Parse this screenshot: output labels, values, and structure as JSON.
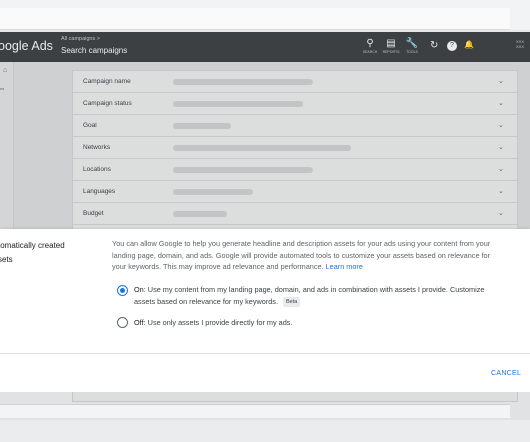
{
  "app": {
    "brand": "oogle Ads",
    "breadcrumb_small": "All campaigns  >",
    "breadcrumb_main": "Search campaigns",
    "tools": [
      {
        "icon": "search-icon",
        "glyph": "⚲",
        "label": "SEARCH"
      },
      {
        "icon": "reports-icon",
        "glyph": "▤",
        "label": "REPORTS"
      },
      {
        "icon": "tools-icon",
        "glyph": "🔧",
        "label": "TOOLS"
      }
    ],
    "refresh_icon": "↻",
    "help_icon": "?",
    "bell_icon": "🔔",
    "account_line1": "XXX",
    "account_line2": "XXX"
  },
  "leftnav": {
    "home_icon": "⌂",
    "text": "ns"
  },
  "settings_rows": [
    {
      "label": "Campaign name",
      "bar": 140
    },
    {
      "label": "Campaign status",
      "bar": 130
    },
    {
      "label": "Goal",
      "bar": 58
    },
    {
      "label": "Networks",
      "bar": 178
    },
    {
      "label": "Locations",
      "bar": 140
    },
    {
      "label": "Languages",
      "bar": 80
    },
    {
      "label": "Budget",
      "bar": 54
    }
  ],
  "dialog": {
    "title_line1": "tomatically created",
    "title_line2": "sets",
    "description": "You can allow Google to help you generate headline and description assets for your ads using your content from your landing page, domain, and ads. Google will provide automated tools to customize your assets based on relevance for your keywords. This may improve ad relevance and performance.",
    "learn_more": "Learn more",
    "option_on_prefix": "On:",
    "option_on_text": "Use my content from my landing page, domain, and ads in combination with assets I provide. Customize assets based on relevance for my keywords.",
    "beta_label": "Beta",
    "option_off_prefix": "Off:",
    "option_off_text": "Use only assets I provide directly for my ads.",
    "selected": "on",
    "cancel_label": "CANCEL"
  }
}
